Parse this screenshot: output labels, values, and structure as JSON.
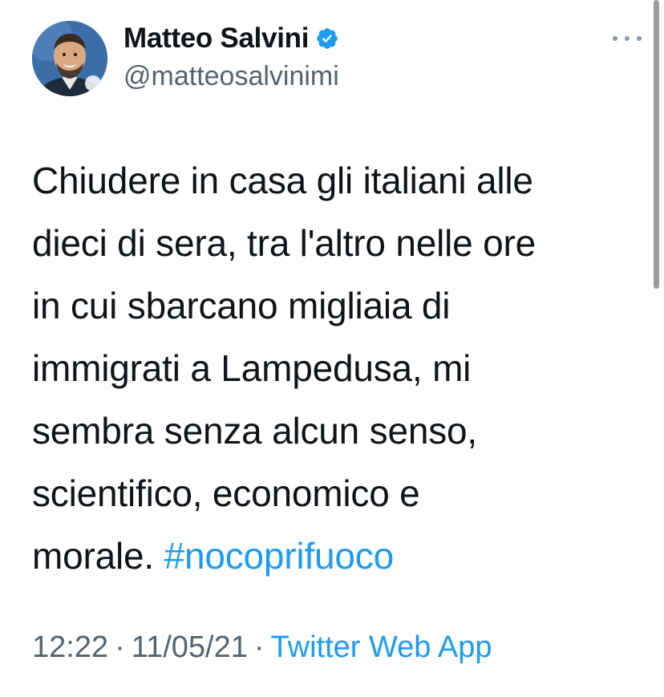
{
  "tweet": {
    "author": {
      "display_name": "Matteo Salvini",
      "handle": "@matteosalvinimi",
      "verified": true
    },
    "text_lines": [
      "Chiudere in casa gli italiani alle",
      "dieci di sera, tra l'altro nelle ore",
      "in cui sbarcano migliaia di",
      "immigrati a Lampedusa, mi",
      "sembra senza alcun senso,",
      "scientifico, economico e",
      "morale."
    ],
    "hashtag": "#nocoprifuoco",
    "time": "12:22",
    "date": "11/05/21",
    "source": "Twitter Web App",
    "separator": "·"
  },
  "colors": {
    "accent": "#1d9bf0",
    "text": "#0f1419",
    "secondary": "#536471"
  },
  "icons": {
    "verified": "verified-badge-icon",
    "more": "more-options-icon"
  }
}
